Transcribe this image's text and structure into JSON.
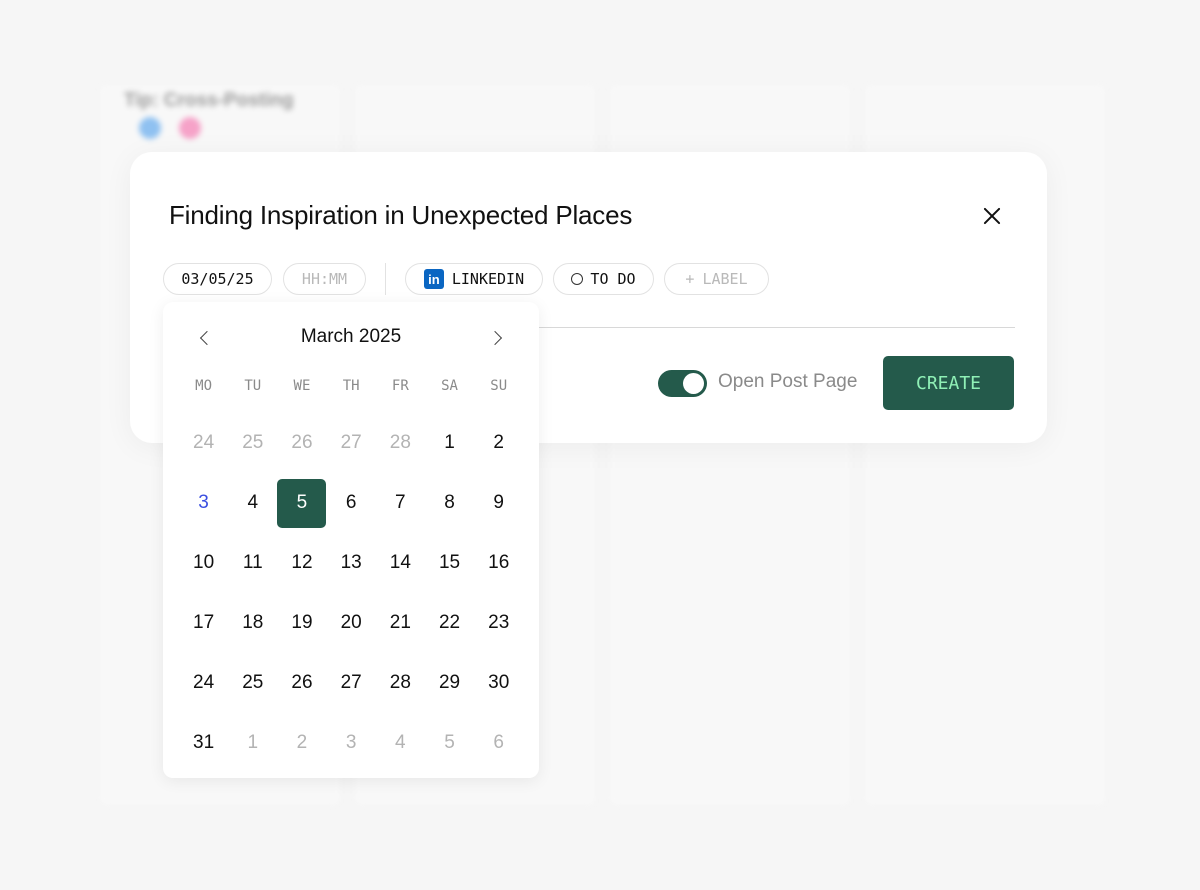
{
  "background": {
    "tip_text": "Tip: Cross-Posting",
    "dot_colors": [
      "#8fc1f1",
      "#f6a2c8"
    ]
  },
  "modal": {
    "title": "Finding Inspiration in Unexpected Places",
    "date_value": "03/05/25",
    "time_placeholder": "HH:MM",
    "network": {
      "icon": "linkedin-icon",
      "label": "LINKEDIN"
    },
    "status": {
      "icon": "circle-icon",
      "label": "TO DO"
    },
    "label_button": {
      "icon": "plus-icon",
      "label": "LABEL"
    },
    "toggle": {
      "label": "Open Post Page",
      "on": true
    },
    "create_label": "CREATE",
    "accent": "#245a4b",
    "create_text_color": "#8ff0b6"
  },
  "calendar": {
    "month": "March 2025",
    "weekdays": [
      "MO",
      "TU",
      "WE",
      "TH",
      "FR",
      "SA",
      "SU"
    ],
    "selected": "5",
    "today": "3",
    "days": [
      {
        "d": "24",
        "muted": true
      },
      {
        "d": "25",
        "muted": true
      },
      {
        "d": "26",
        "muted": true
      },
      {
        "d": "27",
        "muted": true
      },
      {
        "d": "28",
        "muted": true
      },
      {
        "d": "1"
      },
      {
        "d": "2"
      },
      {
        "d": "3",
        "today": true
      },
      {
        "d": "4"
      },
      {
        "d": "5",
        "selected": true
      },
      {
        "d": "6"
      },
      {
        "d": "7"
      },
      {
        "d": "8"
      },
      {
        "d": "9"
      },
      {
        "d": "10"
      },
      {
        "d": "11"
      },
      {
        "d": "12"
      },
      {
        "d": "13"
      },
      {
        "d": "14"
      },
      {
        "d": "15"
      },
      {
        "d": "16"
      },
      {
        "d": "17"
      },
      {
        "d": "18"
      },
      {
        "d": "19"
      },
      {
        "d": "20"
      },
      {
        "d": "21"
      },
      {
        "d": "22"
      },
      {
        "d": "23"
      },
      {
        "d": "24"
      },
      {
        "d": "25"
      },
      {
        "d": "26"
      },
      {
        "d": "27"
      },
      {
        "d": "28"
      },
      {
        "d": "29"
      },
      {
        "d": "30"
      },
      {
        "d": "31"
      },
      {
        "d": "1",
        "muted": true
      },
      {
        "d": "2",
        "muted": true
      },
      {
        "d": "3",
        "muted": true
      },
      {
        "d": "4",
        "muted": true
      },
      {
        "d": "5",
        "muted": true
      },
      {
        "d": "6",
        "muted": true
      }
    ]
  }
}
